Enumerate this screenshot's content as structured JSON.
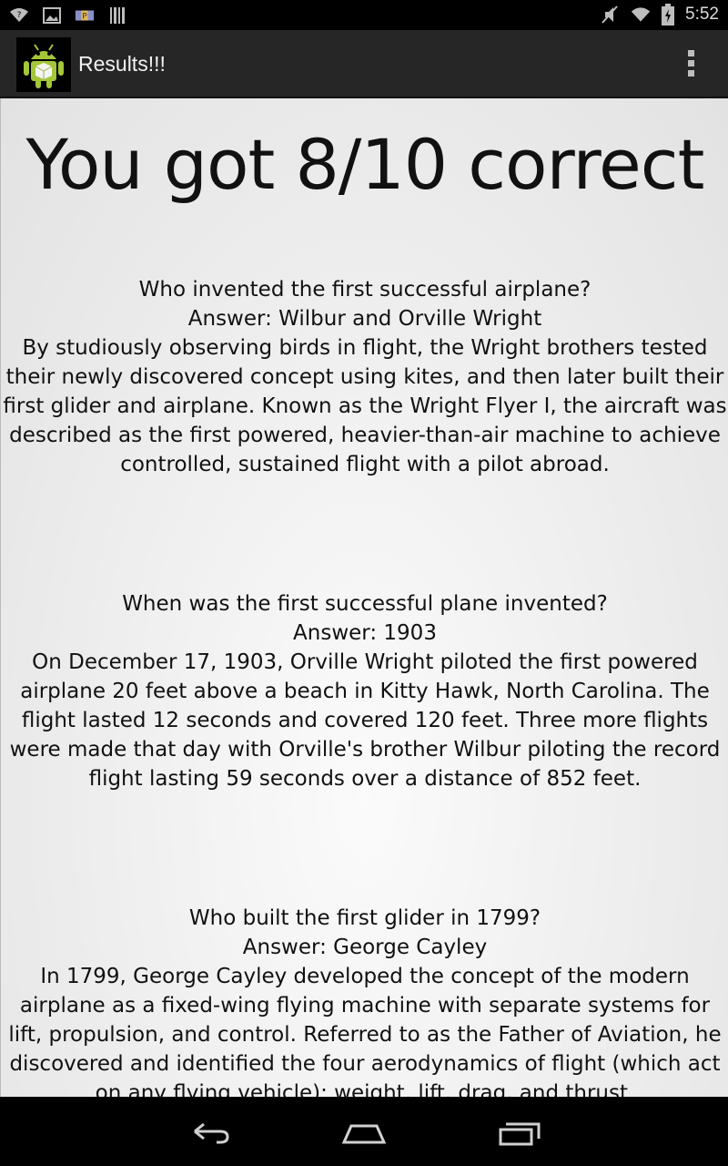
{
  "status_bar": {
    "time": "5:52",
    "left_icons": [
      "wifi-question-icon",
      "image-icon",
      "p-badge-icon",
      "barcode-icon"
    ],
    "right_icons": [
      "muted-icon",
      "wifi-icon",
      "battery-icon"
    ]
  },
  "action_bar": {
    "title": "Results!!!",
    "app_icon": "android-robot-icon",
    "overflow_icon": "overflow-menu-icon"
  },
  "results": {
    "score_text": "You got 8/10 correct",
    "questions": [
      {
        "text": "Who invented the first successful airplane?\n Answer: Wilbur and Orville Wright \n By studiously observing birds in flight, the Wright brothers tested their newly discovered concept using kites, and then later built their first glider and airplane. Known as the Wright Flyer I, the aircraft was described as the first powered, heavier-than-air machine to achieve controlled, sustained flight with a pilot abroad."
      },
      {
        "text": "When was the first successful plane invented?\n Answer: 1903 \n On December 17, 1903, Orville Wright piloted the first powered airplane 20 feet above a beach in Kitty Hawk, North Carolina. The flight lasted 12 seconds and covered 120 feet. Three more flights were made that day with Orville's brother Wilbur piloting the record flight lasting 59 seconds over a distance of 852 feet."
      },
      {
        "text": "Who built the first glider in 1799?\n Answer: George Cayley \n In 1799, George Cayley developed the concept of the modern airplane as a fixed-wing flying machine with separate systems for lift, propulsion, and control. Referred to as the Father of Aviation, he discovered and identified the four aerodynamics of flight (which act on any flying vehicle): weight, lift, drag, and thrust."
      }
    ]
  },
  "nav_bar": {
    "buttons": [
      "back-icon",
      "home-icon",
      "recent-apps-icon"
    ]
  }
}
